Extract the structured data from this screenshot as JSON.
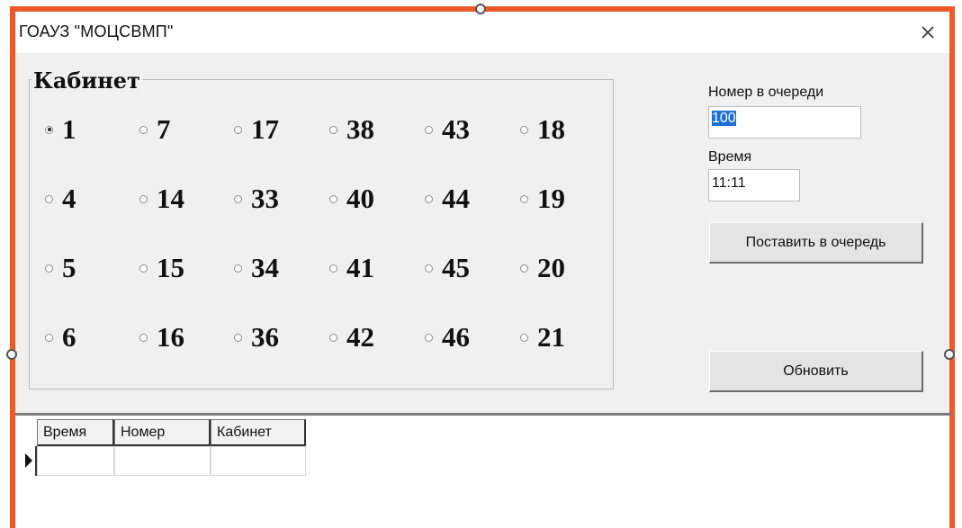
{
  "window": {
    "title": "ГОАУЗ \"МОЦСВМП\"",
    "close_icon": "close-icon"
  },
  "group": {
    "legend": "Кабинет",
    "options": [
      "1",
      "7",
      "17",
      "38",
      "43",
      "18",
      "4",
      "14",
      "33",
      "40",
      "44",
      "19",
      "5",
      "15",
      "34",
      "41",
      "45",
      "20",
      "6",
      "16",
      "36",
      "42",
      "46",
      "21"
    ],
    "selected": "1"
  },
  "queue": {
    "label": "Номер в очереди",
    "value": "100"
  },
  "time": {
    "label": "Время",
    "value": "11:11"
  },
  "buttons": {
    "enqueue": "Поставить в очередь",
    "refresh": "Обновить"
  },
  "table": {
    "columns": [
      "Время",
      "Номер",
      "Кабинет"
    ],
    "row_indicator_icon": "row-pointer-icon"
  },
  "colors": {
    "border": "#ec5a2a",
    "selection": "#1f6ed4"
  }
}
